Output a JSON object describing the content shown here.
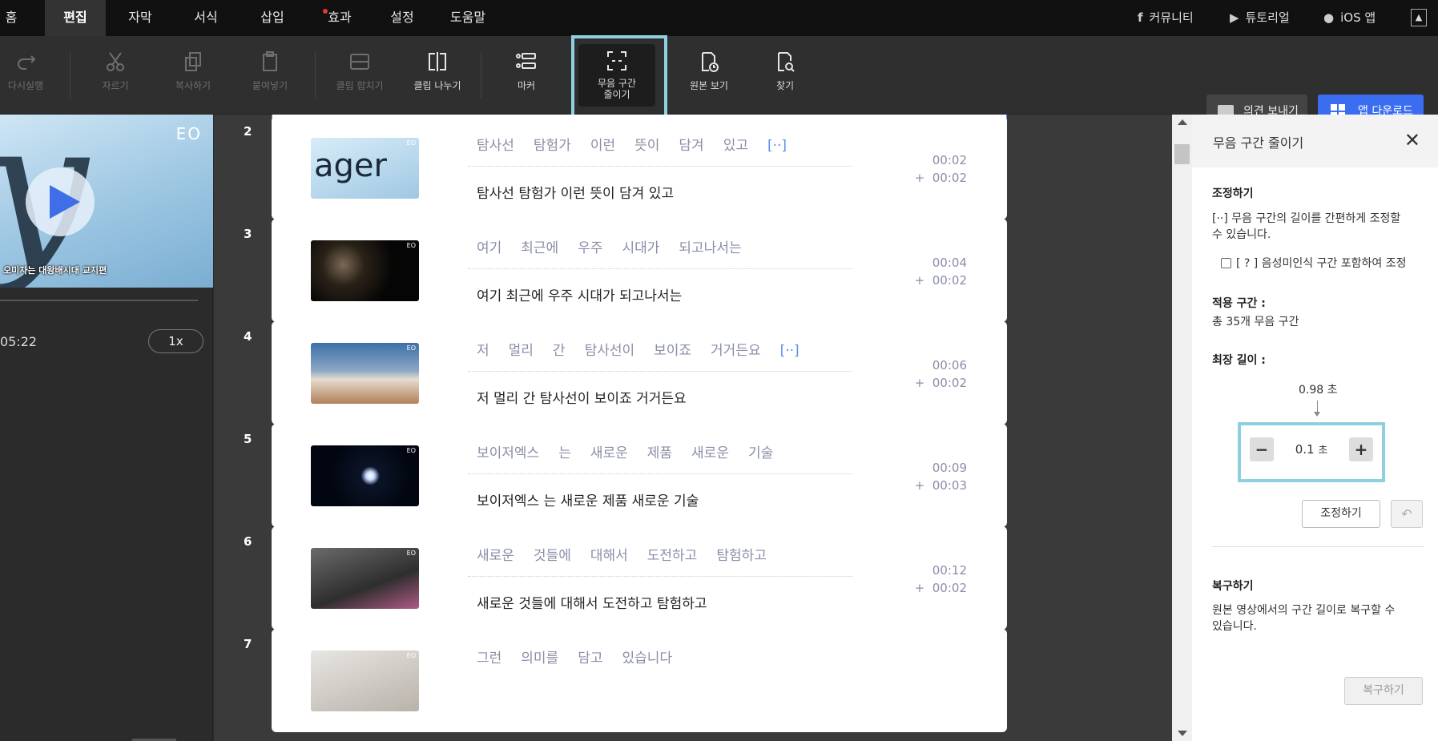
{
  "menu": {
    "tabs": [
      {
        "label": "홈"
      },
      {
        "label": "편집"
      },
      {
        "label": "자막"
      },
      {
        "label": "서식"
      },
      {
        "label": "삽입"
      },
      {
        "label": "효과"
      },
      {
        "label": "설정"
      },
      {
        "label": "도움말"
      }
    ],
    "community": "커뮤니티",
    "tutorial": "튜토리얼",
    "ios_app": "iOS 앱",
    "collapse_icon": "collapse-up-icon"
  },
  "toolbar": {
    "tools": [
      {
        "label": "다시실행",
        "icon": "redo-icon",
        "enabled": false
      },
      {
        "label": "자르기",
        "icon": "scissors-icon",
        "enabled": false
      },
      {
        "label": "복사하기",
        "icon": "copy-icon",
        "enabled": false
      },
      {
        "label": "붙여넣기",
        "icon": "paste-icon",
        "enabled": false
      },
      {
        "label": "클립 합치기",
        "icon": "merge-clip-icon",
        "enabled": false
      },
      {
        "label": "클립 나누기",
        "icon": "split-clip-icon",
        "enabled": true
      },
      {
        "label": "마커",
        "icon": "marker-icon",
        "enabled": true
      },
      {
        "label_line1": "무음 구간",
        "label_line2": "줄이기",
        "icon": "shorten-silence-icon",
        "enabled": true,
        "selected": true
      },
      {
        "label": "원본 보기",
        "icon": "view-original-icon",
        "enabled": true
      },
      {
        "label": "찾기",
        "icon": "find-icon",
        "enabled": true
      }
    ],
    "feedback": "의견 보내기",
    "download": "앱 다운로드"
  },
  "player": {
    "logo": "EO",
    "caption": "오미자는 대왕배시대 교지편",
    "timecode": "05:22",
    "speed": "1x"
  },
  "clips": [
    {
      "num": "2",
      "words": [
        "탐사선",
        "탐험가",
        "이런",
        "뜻이",
        "담겨",
        "있고",
        "[··]"
      ],
      "sentence": "탐사선 탐험가 이런 뜻이 담겨 있고",
      "time": "00:02",
      "delta": "+  00:02",
      "thumb": "ager"
    },
    {
      "num": "3",
      "words": [
        "여기",
        "최근에",
        "우주",
        "시대가",
        "되고나서는"
      ],
      "sentence": "여기 최근에 우주 시대가 되고나서는",
      "time": "00:04",
      "delta": "+  00:02",
      "thumb": "space"
    },
    {
      "num": "4",
      "words": [
        "저",
        "멀리",
        "간",
        "탐사선이",
        "보이죠",
        "거거든요",
        "[··]"
      ],
      "sentence": "저 멀리 간 탐사선이 보이죠 거거든요",
      "time": "00:06",
      "delta": "+  00:02",
      "thumb": "rocket"
    },
    {
      "num": "5",
      "words": [
        "보이저엑스",
        "는",
        "새로운",
        "제품",
        "새로운",
        "기술"
      ],
      "sentence": "보이저엑스 는 새로운 제품 새로운 기술",
      "time": "00:09",
      "delta": "+  00:03",
      "thumb": "night"
    },
    {
      "num": "6",
      "words": [
        "새로운",
        "것들에",
        "대해서",
        "도전하고",
        "탐험하고"
      ],
      "sentence": "새로운 것들에 대해서 도전하고 탐험하고",
      "time": "00:12",
      "delta": "+  00:02",
      "thumb": "keyboard"
    },
    {
      "num": "7",
      "words": [
        "그런",
        "의미를",
        "담고",
        "있습니다"
      ],
      "sentence": "",
      "time": "",
      "delta": "",
      "thumb": "person"
    }
  ],
  "side_panel": {
    "title": "무음 구간 줄이기",
    "adjust_heading": "조정하기",
    "adjust_desc_1": "[··] 무음 구간의 길이를 간편하게 조정할",
    "adjust_desc_2": "수 있습니다.",
    "include_unrecognized": "[ ? ] 음성미인식 구간 포함하여 조정",
    "range_heading": "적용 구간 :",
    "range_value": "총 35개 무음 구간",
    "max_heading": "최장 길이 :",
    "max_value": "0.98 초",
    "stepper_value": "0.1",
    "stepper_unit": "초",
    "adjust_button": "조정하기",
    "restore_heading": "복구하기",
    "restore_desc_1": "원본 영상에서의 구간 길이로 복구할 수",
    "restore_desc_2": "있습니다.",
    "restore_button": "복구하기"
  }
}
